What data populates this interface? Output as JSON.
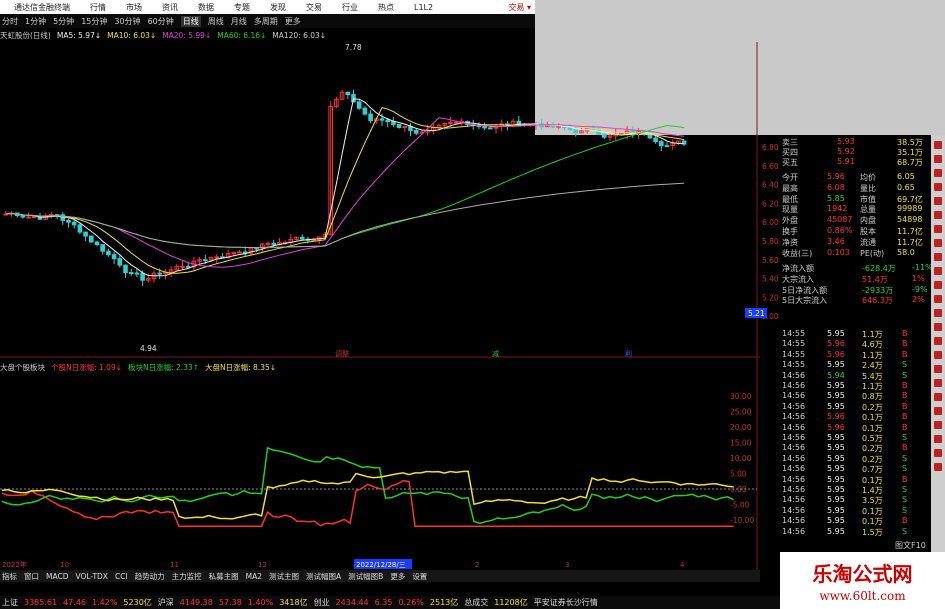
{
  "titlebar": {
    "app_name": "通达信金融终端",
    "menus": [
      "行情",
      "市场",
      "资讯",
      "数据",
      "专题",
      "发现",
      "交易",
      "行业",
      "热点",
      "L1L2"
    ],
    "right": "交易 ▾"
  },
  "periods": [
    "分时",
    "1分钟",
    "5分钟",
    "15分钟",
    "30分钟",
    "60分钟",
    "日线",
    "周线",
    "月线",
    "多周期",
    "更多"
  ],
  "selected_period": "日线",
  "ma_legend": [
    {
      "text": "天虹股份(日线)",
      "color": "#cccccc"
    },
    {
      "text": "MA5: 5.97↓",
      "color": "#eeeeee"
    },
    {
      "text": "MA10: 6.03↓",
      "color": "#f0e030"
    },
    {
      "text": "MA20: 5.99↓",
      "color": "#e040e0"
    },
    {
      "text": "MA60: 6.16↓",
      "color": "#20d020"
    },
    {
      "text": "MA120: 6.03↓",
      "color": "#cccccc"
    }
  ],
  "price_high_label": "7.78",
  "price_low_label": "4.94",
  "price_axis": [
    "6.80",
    "6.60",
    "6.40",
    "6.20",
    "6.00",
    "5.80",
    "5.60",
    "5.40",
    "5.20",
    "5.00"
  ],
  "current_price_tag": "5.21",
  "event_markers": [
    "调整",
    "减",
    "利"
  ],
  "ind_legend": [
    {
      "text": "大盘个股板块",
      "color": "#cccccc"
    },
    {
      "text": "个股N日涨幅: 1.09↓",
      "color": "#ff3030"
    },
    {
      "text": "板块N日涨幅: 2.33↑",
      "color": "#20d020"
    },
    {
      "text": "大盘N日涨幅: 8.35↓",
      "color": "#f0e030"
    }
  ],
  "ind_axis": [
    "30.00",
    "25.00",
    "20.00",
    "15.00",
    "10.00",
    "5.00",
    "0.00",
    "-5.00",
    "-10.00"
  ],
  "date_axis": [
    "2022年",
    "10",
    "11",
    "12",
    "2022/12/28/三",
    "2",
    "3",
    "4"
  ],
  "bottom_tabs": [
    "指标",
    "窗口",
    "MACD",
    "VOL-TDX",
    "CCI",
    "趋势动力",
    "主力监控",
    "私募主图",
    "MA2",
    "测试主图",
    "测试幅图A",
    "测试幅图B",
    "更多",
    "设置"
  ],
  "quote_top": [
    {
      "label": "卖三",
      "price": "5.93",
      "vol": "38.5万"
    },
    {
      "label": "买四",
      "price": "5.92",
      "vol": "35.1万"
    },
    {
      "label": "买五",
      "price": "5.91",
      "vol": "68.7万"
    }
  ],
  "quote_stats": [
    {
      "l1": "今开",
      "v1": "5.96",
      "l2": "均价",
      "v2": "6.05"
    },
    {
      "l1": "最高",
      "v1": "6.08",
      "l2": "量比",
      "v2": "0.65"
    },
    {
      "l1": "最低",
      "v1": "5.85",
      "l2": "市值",
      "v2": "69.7亿"
    },
    {
      "l1": "现量",
      "v1": "1942",
      "l2": "总量",
      "v2": "99989"
    },
    {
      "l1": "外盘",
      "v1": "45087",
      "l2": "内盘",
      "v2": "54898"
    },
    {
      "l1": "换手",
      "v1": "0.86%",
      "l2": "股本",
      "v2": "11.7亿"
    },
    {
      "l1": "净资",
      "v1": "3.46",
      "l2": "流通",
      "v2": "11.7亿"
    },
    {
      "l1": "收益(三)",
      "v1": "0.103",
      "l2": "PE(动)",
      "v2": "58.0"
    }
  ],
  "flow_rows": [
    {
      "label": "净流入额",
      "val": "-628.4万",
      "pct": "-11%"
    },
    {
      "label": "大宗流入",
      "val": "51.4万",
      "pct": "1%"
    },
    {
      "label": "5日净流入额",
      "val": "-2933万",
      "pct": "-9%"
    },
    {
      "label": "5日大宗流入",
      "val": "646.3万",
      "pct": "2%"
    }
  ],
  "ticks": [
    {
      "t": "14:55",
      "p": "5.95",
      "v": "1.1万",
      "s": "B"
    },
    {
      "t": "14:55",
      "p": "5.96",
      "v": "4.6万",
      "s": "B"
    },
    {
      "t": "14:55",
      "p": "5.96",
      "v": "1.1万",
      "s": "B"
    },
    {
      "t": "14:55",
      "p": "5.95",
      "v": "2.4万",
      "s": "S"
    },
    {
      "t": "14:56",
      "p": "5.94",
      "v": "5.4万",
      "s": "S"
    },
    {
      "t": "14:56",
      "p": "5.95",
      "v": "1.1万",
      "s": "B"
    },
    {
      "t": "14:56",
      "p": "5.95",
      "v": "0.8万",
      "s": "B"
    },
    {
      "t": "14:56",
      "p": "5.95",
      "v": "0.2万",
      "s": "B"
    },
    {
      "t": "14:56",
      "p": "5.96",
      "v": "0.1万",
      "s": "B"
    },
    {
      "t": "14:56",
      "p": "5.96",
      "v": "0.1万",
      "s": "B"
    },
    {
      "t": "14:56",
      "p": "5.95",
      "v": "0.5万",
      "s": "S"
    },
    {
      "t": "14:56",
      "p": "5.95",
      "v": "0.2万",
      "s": "B"
    },
    {
      "t": "14:56",
      "p": "5.95",
      "v": "0.2万",
      "s": "S"
    },
    {
      "t": "14:56",
      "p": "5.95",
      "v": "0.7万",
      "s": "S"
    },
    {
      "t": "14:56",
      "p": "5.95",
      "v": "0.1万",
      "s": "B"
    },
    {
      "t": "14:56",
      "p": "5.95",
      "v": "1.4万",
      "s": "S"
    },
    {
      "t": "14:56",
      "p": "5.95",
      "v": "3.5万",
      "s": "S"
    },
    {
      "t": "14:56",
      "p": "5.95",
      "v": "0.1万",
      "s": "S"
    },
    {
      "t": "14:56",
      "p": "5.95",
      "v": "0.1万",
      "s": "B"
    },
    {
      "t": "14:56",
      "p": "5.95",
      "v": "1.5万",
      "s": "S"
    }
  ],
  "quote_tabs_label": "图文F10",
  "status": [
    {
      "text": "上证",
      "color": "#dddddd"
    },
    {
      "text": "3385.61",
      "color": "#ff3030"
    },
    {
      "text": "47.46",
      "color": "#ff3030"
    },
    {
      "text": "1.42%",
      "color": "#ff3030"
    },
    {
      "text": "5230亿",
      "color": "#f0e030"
    },
    {
      "text": "沪深",
      "color": "#dddddd"
    },
    {
      "text": "4149.38",
      "color": "#ff3030"
    },
    {
      "text": "57.38",
      "color": "#ff3030"
    },
    {
      "text": "1.40%",
      "color": "#ff3030"
    },
    {
      "text": "3418亿",
      "color": "#f0e030"
    },
    {
      "text": "创业",
      "color": "#dddddd"
    },
    {
      "text": "2434.44",
      "color": "#ff3030"
    },
    {
      "text": "6.35",
      "color": "#ff3030"
    },
    {
      "text": "0.26%",
      "color": "#ff3030"
    },
    {
      "text": "2513亿",
      "color": "#f0e030"
    },
    {
      "text": "总成交",
      "color": "#dddddd"
    },
    {
      "text": "11208亿",
      "color": "#f0e030"
    },
    {
      "text": "平安证券长沙行情",
      "color": "#dddddd"
    }
  ],
  "watermark": {
    "line1": "乐淘公式网",
    "line2": "www.60lt.com"
  }
}
